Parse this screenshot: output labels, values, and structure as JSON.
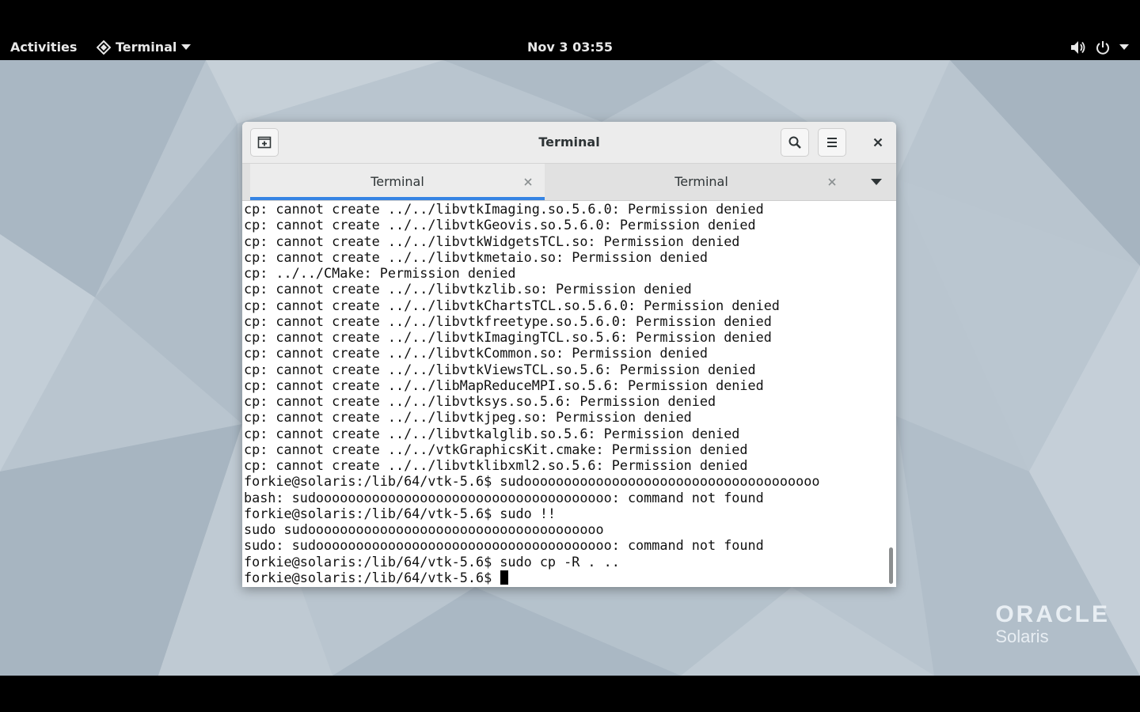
{
  "topbar": {
    "activities_label": "Activities",
    "app_menu_label": "Terminal",
    "clock": "Nov 3  03:55"
  },
  "window": {
    "title": "Terminal",
    "tabs": [
      {
        "label": "Terminal",
        "active": true
      },
      {
        "label": "Terminal",
        "active": false
      }
    ]
  },
  "terminal": {
    "lines": [
      "cp: cannot create ../../libvtkImaging.so.5.6.0: Permission denied",
      "cp: cannot create ../../libvtkGeovis.so.5.6.0: Permission denied",
      "cp: cannot create ../../libvtkWidgetsTCL.so: Permission denied",
      "cp: cannot create ../../libvtkmetaio.so: Permission denied",
      "cp: ../../CMake: Permission denied",
      "cp: cannot create ../../libvtkzlib.so: Permission denied",
      "cp: cannot create ../../libvtkChartsTCL.so.5.6.0: Permission denied",
      "cp: cannot create ../../libvtkfreetype.so.5.6.0: Permission denied",
      "cp: cannot create ../../libvtkImagingTCL.so.5.6: Permission denied",
      "cp: cannot create ../../libvtkCommon.so: Permission denied",
      "cp: cannot create ../../libvtkViewsTCL.so.5.6: Permission denied",
      "cp: cannot create ../../libMapReduceMPI.so.5.6: Permission denied",
      "cp: cannot create ../../libvtksys.so.5.6: Permission denied",
      "cp: cannot create ../../libvtkjpeg.so: Permission denied",
      "cp: cannot create ../../libvtkalglib.so.5.6: Permission denied",
      "cp: cannot create ../../vtkGraphicsKit.cmake: Permission denied",
      "cp: cannot create ../../libvtklibxml2.so.5.6: Permission denied",
      "forkie@solaris:/lib/64/vtk-5.6$ sudooooooooooooooooooooooooooooooooooooo",
      "bash: sudooooooooooooooooooooooooooooooooooooo: command not found",
      "forkie@solaris:/lib/64/vtk-5.6$ sudo !!",
      "sudo sudooooooooooooooooooooooooooooooooooooo",
      "sudo: sudooooooooooooooooooooooooooooooooooooo: command not found",
      "forkie@solaris:/lib/64/vtk-5.6$ sudo cp -R . .."
    ],
    "prompt": "forkie@solaris:/lib/64/vtk-5.6$ "
  },
  "wallpaper": {
    "brand_name": "ORACLE",
    "brand_product": "Solaris"
  },
  "colors": {
    "accent": "#3584e4",
    "topbar": "#000000",
    "wallpaper": "#b7c3cd"
  }
}
